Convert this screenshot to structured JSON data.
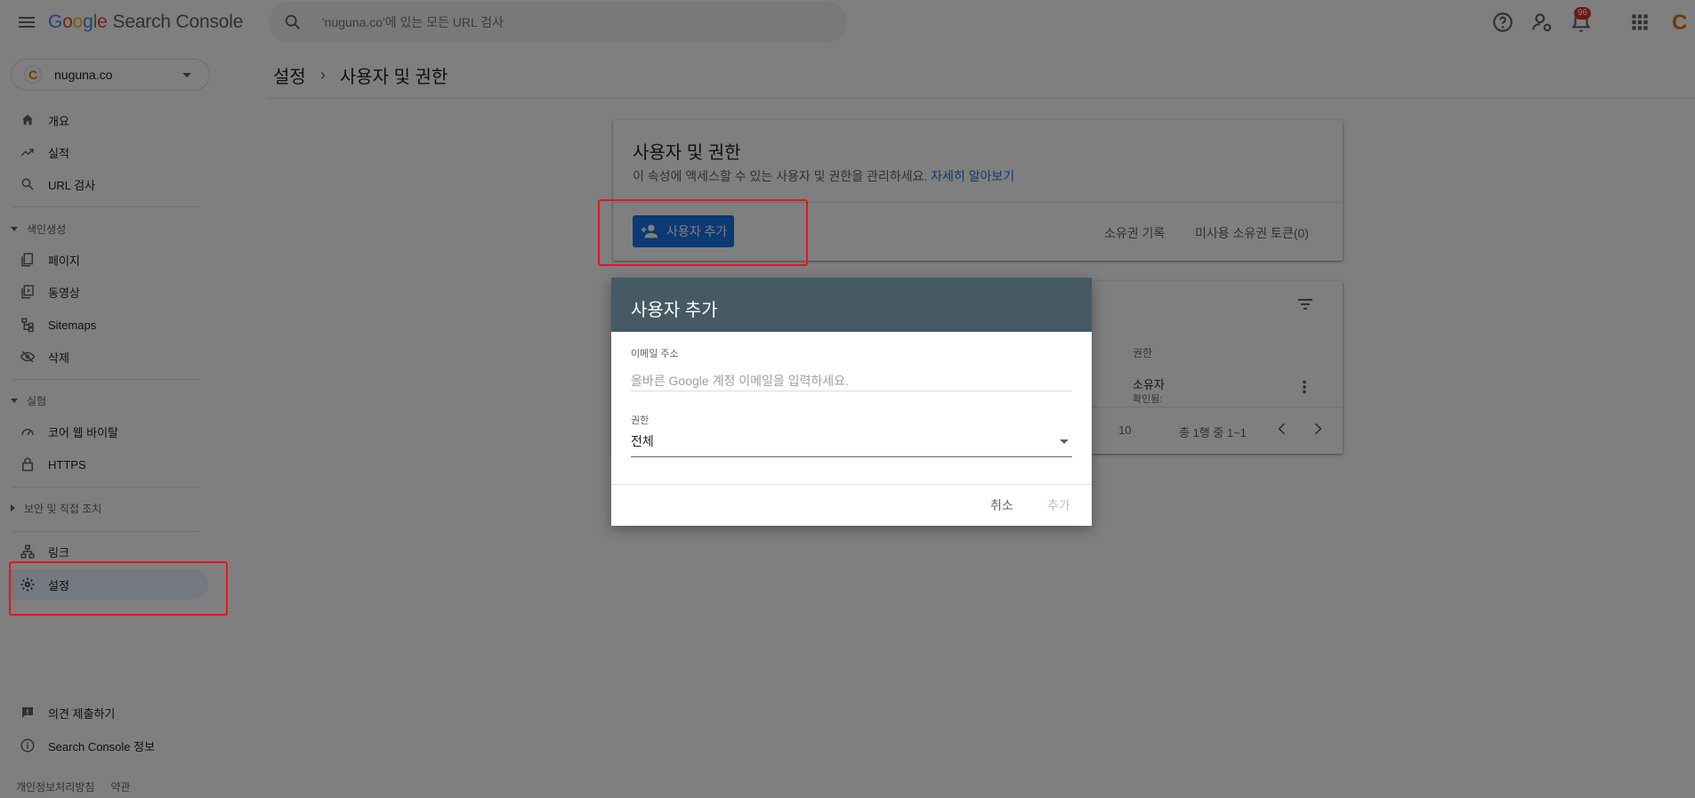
{
  "topbar": {
    "menu_icon": "menu-icon",
    "logo_letters": [
      "G",
      "o",
      "o",
      "g",
      "l",
      "e"
    ],
    "product": "Search Console",
    "search_placeholder": "'nuguna.co'에 있는 모든 URL 검사",
    "notification_count": "96",
    "avatar_letter": "C"
  },
  "sidebar": {
    "property": {
      "logo": "C",
      "name": "nuguna.co"
    },
    "items_top": [
      {
        "label": "개요",
        "icon": "home-icon"
      },
      {
        "label": "실적",
        "icon": "trending-up-icon"
      },
      {
        "label": "URL 검사",
        "icon": "search-icon"
      }
    ],
    "section_index": "색인생성",
    "items_index": [
      {
        "label": "페이지",
        "icon": "pages-icon"
      },
      {
        "label": "동영상",
        "icon": "video-icon"
      },
      {
        "label": "Sitemaps",
        "icon": "sitemap-icon"
      },
      {
        "label": "삭제",
        "icon": "eye-off-icon"
      }
    ],
    "section_experience": "실험",
    "items_experience": [
      {
        "label": "코어 웹 바이탈",
        "icon": "speed-icon"
      },
      {
        "label": "HTTPS",
        "icon": "lock-icon"
      }
    ],
    "section_security": "보안 및 직접 조치",
    "items_bottom": [
      {
        "label": "링크",
        "icon": "links-icon"
      },
      {
        "label": "설정",
        "icon": "gear-icon"
      }
    ],
    "items_footer": [
      {
        "label": "의견 제출하기",
        "icon": "feedback-icon"
      },
      {
        "label": "Search Console 정보",
        "icon": "info-icon"
      }
    ],
    "legal": [
      "개인정보처리방침",
      "약관"
    ]
  },
  "main": {
    "breadcrumb": [
      "설정",
      "사용자 및 권한"
    ],
    "card": {
      "title": "사용자 및 권한",
      "description": "이 속성에 액세스할 수 있는 사용자 및 권한을 관리하세요.",
      "learn_more": "자세히 알아보기",
      "add_user": "사용자 추가",
      "ownership_history": "소유권 기록",
      "unused_tokens": "미사용 소유권 토큰(0)"
    },
    "table": {
      "col_permission": "권한",
      "row_role": "소유자",
      "row_verified": "확인됨:",
      "rows_per_page_suffix": "10",
      "range": "총 1행 중 1~1"
    }
  },
  "dialog": {
    "title": "사용자 추가",
    "email_label": "이메일 주소",
    "email_placeholder": "올바른 Google 계정 이메일을 입력하세요.",
    "permission_label": "권한",
    "permission_value": "전체",
    "cancel": "취소",
    "add": "추가"
  },
  "colors": {
    "accent": "#1a73e8",
    "dialog_header": "#455a64",
    "highlight": "#e8141b"
  }
}
